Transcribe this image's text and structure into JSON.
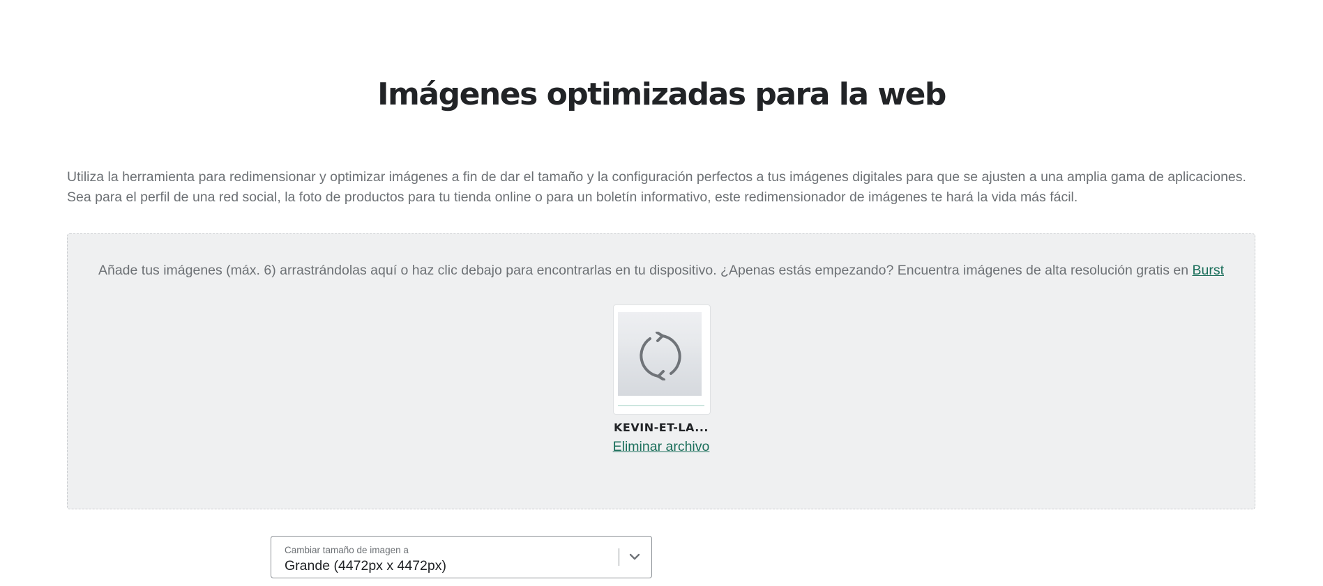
{
  "page": {
    "title": "Imágenes optimizadas para la web",
    "intro_line1": "Utiliza la herramienta para redimensionar y optimizar imágenes a fin de dar el tamaño y la configuración perfectos a tus imágenes digitales para que se ajusten a una amplia gama de aplicaciones.",
    "intro_line2": "Sea para el perfil de una red social, la foto de productos para tu tienda online o para un boletín informativo, este redimensionador de imágenes te hará la vida más fácil."
  },
  "dropzone": {
    "instructions": "Añade tus imágenes (máx. 6) arrastrándolas aquí o haz clic debajo para encontrarlas en tu dispositivo. ¿Apenas estás empezando? Encuentra imágenes de alta resolución gratis en",
    "burst_link": "Burst",
    "file": {
      "name": "KEVIN-ET-LA...",
      "status_icon": "refresh-icon",
      "remove_label": "Eliminar archivo"
    }
  },
  "resize_select": {
    "label": "Cambiar tamaño de imagen a",
    "value": "Grande (4472px x 4472px)",
    "icon": "chevron-down-icon"
  },
  "colors": {
    "link": "#1a6e5a",
    "title": "#212326",
    "body_text": "#6d7175",
    "dropzone_bg": "#eff0f1"
  }
}
